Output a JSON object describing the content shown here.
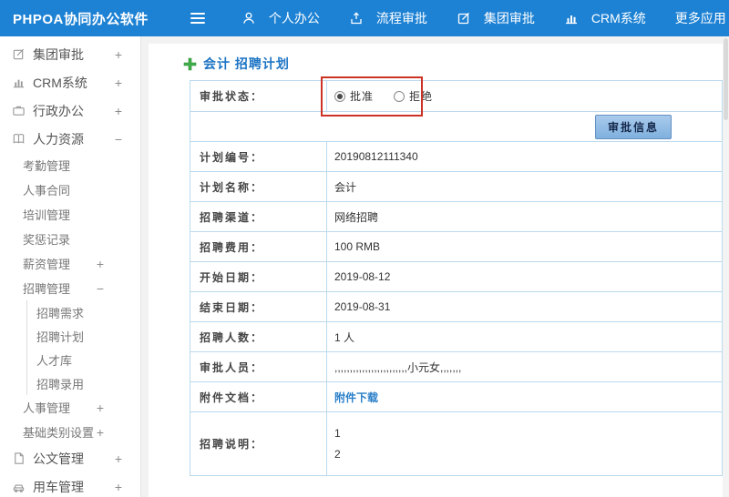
{
  "colors": {
    "navbar_blue": "#1e82d4",
    "title_blue": "#1c74c4",
    "link_blue": "#2a7fc9",
    "table_border": "#bcd9ee",
    "annotation_red": "#cc3326",
    "plus_green": "#3fae49"
  },
  "navbar": {
    "logo": "PHPOA协同办公软件",
    "items": [
      {
        "label": "个人办公",
        "icon": "person-icon"
      },
      {
        "label": "流程审批",
        "icon": "flow-icon"
      },
      {
        "label": "集团审批",
        "icon": "edit-square-icon"
      },
      {
        "label": "CRM系统",
        "icon": "bar-chart-icon"
      },
      {
        "label": "更多应用",
        "icon": "caret-down-icon"
      }
    ]
  },
  "sidebar": {
    "items": [
      {
        "label": "集团审批",
        "toggle": "+"
      },
      {
        "label": "CRM系统",
        "toggle": "+"
      },
      {
        "label": "行政办公",
        "toggle": "+"
      },
      {
        "label": "人力资源",
        "toggle": "−"
      },
      {
        "label": "考勤管理",
        "toggle": ""
      },
      {
        "label": "人事合同",
        "toggle": ""
      },
      {
        "label": "培训管理",
        "toggle": ""
      },
      {
        "label": "奖惩记录",
        "toggle": ""
      },
      {
        "label": "薪资管理",
        "toggle": "+"
      },
      {
        "label": "招聘管理",
        "toggle": "−"
      },
      {
        "label": "招聘需求",
        "toggle": ""
      },
      {
        "label": "招聘计划",
        "toggle": ""
      },
      {
        "label": "人才库",
        "toggle": ""
      },
      {
        "label": "招聘录用",
        "toggle": ""
      },
      {
        "label": "人事管理",
        "toggle": "+"
      },
      {
        "label": "基础类别设置",
        "toggle": "+"
      },
      {
        "label": "公文管理",
        "toggle": "+"
      },
      {
        "label": "用车管理",
        "toggle": "+"
      }
    ]
  },
  "main": {
    "title": "会计 招聘计划"
  },
  "form": {
    "status_label": "审批状态：",
    "status_options": [
      {
        "label": "批准",
        "selected": true
      },
      {
        "label": "拒绝",
        "selected": false
      }
    ],
    "approve_button": "审批信息",
    "fields": [
      {
        "label": "计划编号：",
        "value": "20190812111340"
      },
      {
        "label": "计划名称：",
        "value": "会计"
      },
      {
        "label": "招聘渠道：",
        "value": "网络招聘"
      },
      {
        "label": "招聘费用：",
        "value": "100 RMB"
      },
      {
        "label": "开始日期：",
        "value": "2019-08-12"
      },
      {
        "label": "结束日期：",
        "value": "2019-08-31"
      },
      {
        "label": "招聘人数：",
        "value": "1 人"
      },
      {
        "label": "审批人员：",
        "value": ",,,,,,,,,,,,,,,,,,,,,,,,小元女,,,,,,,"
      },
      {
        "label": "附件文档：",
        "value": "附件下载"
      },
      {
        "label": "招聘说明：",
        "lines": [
          "1",
          "2"
        ]
      }
    ]
  }
}
